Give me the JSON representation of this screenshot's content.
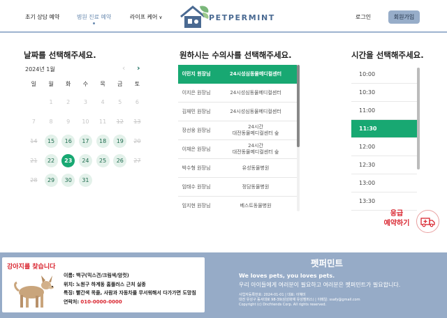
{
  "header": {
    "nav": [
      {
        "label": "초기 상담 예약"
      },
      {
        "label": "병원 진료 예약"
      },
      {
        "label": "라이프 케어"
      }
    ],
    "logo_text": "PETPERMINT",
    "login_label": "로그인",
    "signup_label": "회원가입"
  },
  "calendar": {
    "title": "날짜를 선택해주세요.",
    "month_label": "2024년 1월",
    "weekdays": [
      "일",
      "월",
      "화",
      "수",
      "목",
      "금",
      "토"
    ],
    "weeks": [
      [
        "",
        "1",
        "2",
        "3",
        "4",
        "5",
        "6"
      ],
      [
        "7",
        "8",
        "9",
        "10",
        "11",
        "12",
        "13"
      ],
      [
        "14",
        "15",
        "16",
        "17",
        "18",
        "19",
        "20"
      ],
      [
        "21",
        "22",
        "23",
        "24",
        "25",
        "26",
        "27"
      ],
      [
        "28",
        "29",
        "30",
        "31",
        "",
        "",
        ""
      ]
    ],
    "available_days": [
      "15",
      "16",
      "17",
      "18",
      "19",
      "22",
      "24",
      "25",
      "26",
      "29",
      "30",
      "31"
    ],
    "struck_days": [
      "12",
      "13",
      "14",
      "20",
      "21",
      "27",
      "28"
    ],
    "selected_day": "23"
  },
  "vets": {
    "title": "원하시는 수의사를 선택해주세요.",
    "list": [
      {
        "name": "이민지 원장님",
        "hospital": [
          "24시성심동물메디컬센터"
        ],
        "selected": true
      },
      {
        "name": "이지은 원장님",
        "hospital": [
          "24시성심동물메디컬센터"
        ]
      },
      {
        "name": "김재민 원장님",
        "hospital": [
          "24시성심동물메디컬센터"
        ]
      },
      {
        "name": "장선웅 원장님",
        "hospital": [
          "24시간",
          "대전동물메디컬센터 숲"
        ]
      },
      {
        "name": "이채은 원장님",
        "hospital": [
          "24시간",
          "대전동물메디컬센터 숲"
        ]
      },
      {
        "name": "박수형 원장님",
        "hospital": [
          "유성동물병원"
        ]
      },
      {
        "name": "임태수 원장님",
        "hospital": [
          "정담동물병원"
        ]
      },
      {
        "name": "임지현 원장님",
        "hospital": [
          "베스트동물병원"
        ]
      }
    ]
  },
  "times": {
    "title": "시간을 선택해주세요.",
    "slots": [
      "10:00",
      "10:30",
      "11:00",
      "11:30",
      "12:00",
      "12:30",
      "13:00",
      "13:30"
    ],
    "selected": "11:30"
  },
  "emergency": {
    "line1": "응급",
    "line2": "예약하기"
  },
  "footer": {
    "lost_pet": {
      "title": "강아지를 찾습니다",
      "name_label": "이름:",
      "name_value": "백구(믹스견/크림색/암컷)",
      "location_label": "위치:",
      "location_value": "노원구 하계동 홈플러스 근처 실종",
      "feature_label": "특징:",
      "feature_value": "빨간색 목줄, 사람과 자동차를 무서워해서 다가가면 도망침",
      "contact_label": "연락처:",
      "contact_value": "010-0000-0000"
    },
    "brand": "펫퍼민트",
    "slogan1": "We loves pets, you loves pets.",
    "slogan2": "우리 아이들에게 여러분이 필요하고 여러분은 펫퍼민트가 필요합니다.",
    "company_line1": "사업자등록번호: 2024-01-01 | 대표: 이혜미",
    "company_line2": "대전 유성구 동서대로 98-39(삼성화재 유성캠퍼스) | 이메일: ssafy@gmail.com",
    "company_line3": "Copyright (c) Dncfriends Corp. All rights reserved."
  },
  "colors": {
    "accent_green": "#18a872",
    "brand_blue": "#96abc7",
    "emergency_red": "#d9252f"
  }
}
